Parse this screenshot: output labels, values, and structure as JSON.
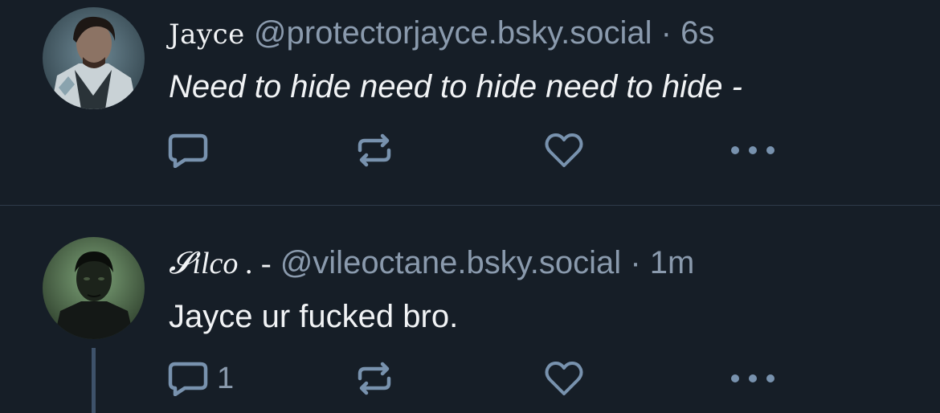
{
  "posts": [
    {
      "display_name": "Jayce",
      "handle": "@protectorjayce.bsky.social",
      "separator": "·",
      "time": "6s",
      "text": "Need to hide need to hide need to hide -",
      "reply_count": "",
      "avatar_icon": "avatar-jayce",
      "actions": [
        "reply-icon",
        "repost-icon",
        "like-icon",
        "more-icon"
      ]
    },
    {
      "display_name": "𝓢ilco . -",
      "handle": "@vileoctane.bsky.social",
      "separator": "·",
      "time": "1m",
      "text": "Jayce ur fucked bro.",
      "reply_count": "1",
      "avatar_icon": "avatar-silco",
      "actions": [
        "reply-icon",
        "repost-icon",
        "like-icon",
        "more-icon"
      ]
    }
  ],
  "colors": {
    "background": "#161e27",
    "text": "#f1f3f5",
    "muted": "#8a9aad",
    "divider": "#2e3b4a",
    "thread_line": "#3e526a"
  }
}
